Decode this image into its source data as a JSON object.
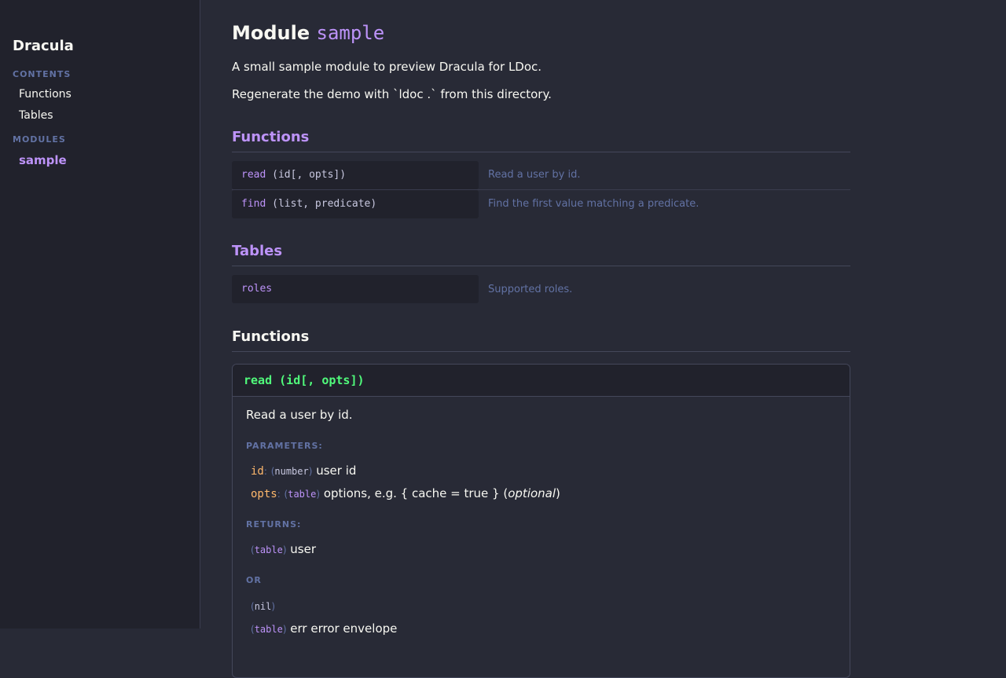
{
  "sidebar": {
    "brand": "Dracula",
    "contents_heading": "CONTENTS",
    "contents": [
      "Functions",
      "Tables"
    ],
    "modules_heading": "MODULES",
    "active_module": "sample"
  },
  "header": {
    "title_prefix": "Module",
    "module_name": "sample",
    "lead1": "A small sample module to preview Dracula for LDoc.",
    "lead2": "Regenerate the demo with `ldoc .` from this directory."
  },
  "summary": {
    "functions_heading": "Functions",
    "functions": [
      {
        "name": "read",
        "args": " (id[, opts])",
        "desc": "Read a user by id."
      },
      {
        "name": "find",
        "args": " (list, predicate)",
        "desc": "Find the first value matching a predicate."
      }
    ],
    "tables_heading": "Tables",
    "tables": [
      {
        "name": "roles",
        "desc": "Supported roles."
      }
    ]
  },
  "details": {
    "heading": "Functions",
    "card": {
      "signature": "read (id[, opts])",
      "description": "Read a user by id.",
      "parameters_label": "PARAMETERS:",
      "params": [
        {
          "name": "id",
          "type": "number",
          "desc": "user id",
          "optional": ""
        },
        {
          "name": "opts",
          "type": "table",
          "desc": "options, e.g. { cache = true }",
          "optional": "optional"
        }
      ],
      "returns_label": "RETURNS:",
      "returns1": {
        "type": "table",
        "desc": "user"
      },
      "or_label": "OR",
      "returns2": {
        "type": "nil",
        "desc": ""
      },
      "returns3": {
        "type": "table",
        "desc": "err error envelope"
      }
    }
  },
  "colors": {
    "background": "#282a36",
    "sidebar": "#21222c",
    "purple": "#bd93f9",
    "green": "#50fa7b",
    "orange": "#ffb86c",
    "comment": "#6272a4",
    "foreground": "#f8f8f2"
  }
}
